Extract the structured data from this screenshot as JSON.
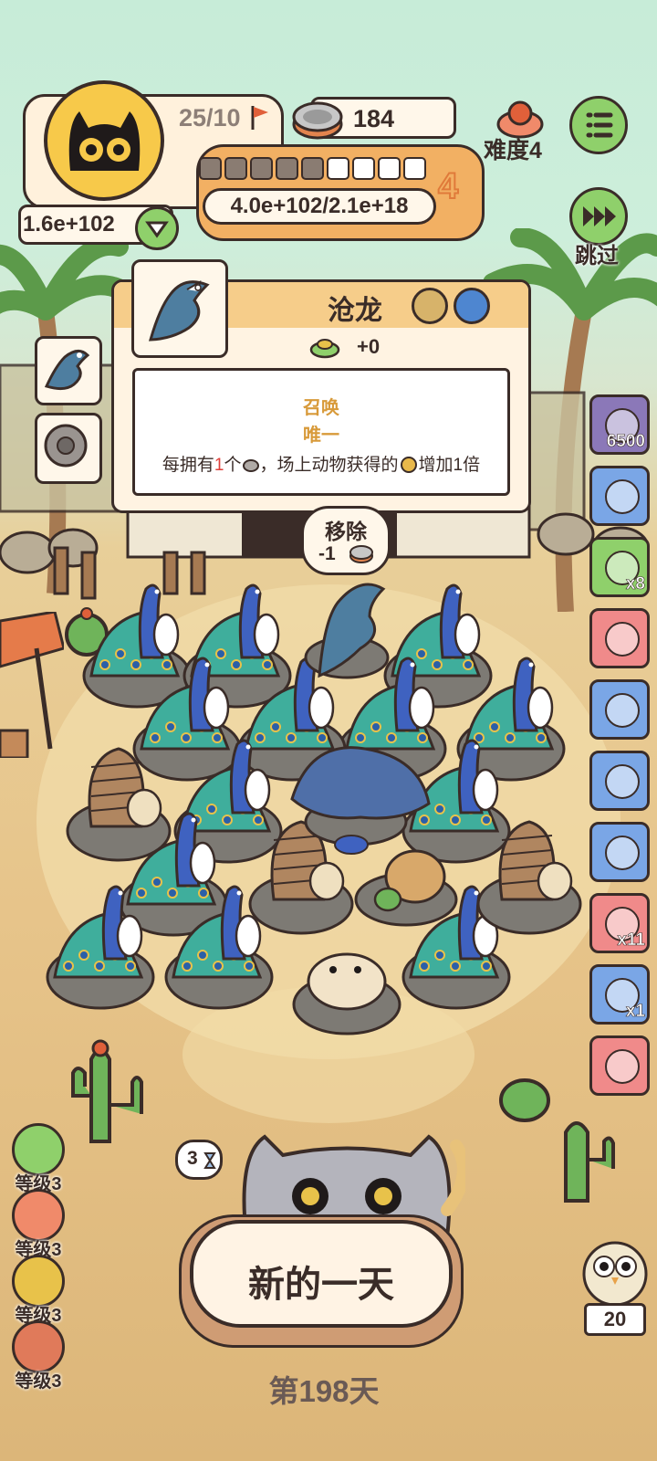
{
  "hud": {
    "capacity": "25/10",
    "cans": "184",
    "difficulty": "难度4",
    "level_number": "4",
    "progress_text": "4.0e+102/2.1e+18",
    "player_score": "1.6e+102",
    "progress_segments": 9,
    "progress_filled": 5,
    "skip_label": "跳过"
  },
  "popup": {
    "name": "沧龙",
    "bonus": "+0",
    "tag1": "召唤",
    "tag2": "唯一",
    "desc_pre": "每拥有",
    "desc_num": "1",
    "desc_mid": "个",
    "desc_post": "，场上动物获得的",
    "desc_end": "增加1倍",
    "remove_label": "移除",
    "remove_cost": "-1"
  },
  "side_buttons": [
    {
      "icon": "stone-film-icon",
      "badge": "6500",
      "color": "#8b78b8"
    },
    {
      "icon": "trophy-icon",
      "badge": "",
      "color": "#7aa6e6"
    },
    {
      "icon": "ticket-icon",
      "badge": "x8",
      "color": "#8fd06b"
    },
    {
      "icon": "paw-plus-icon",
      "badge": "",
      "color": "#f08a8a"
    },
    {
      "icon": "bed-icon",
      "badge": "",
      "color": "#7aa6e6"
    },
    {
      "icon": "backpack-icon",
      "badge": "",
      "color": "#7aa6e6"
    },
    {
      "icon": "jar-icon",
      "badge": "",
      "color": "#7aa6e6"
    },
    {
      "icon": "lock-icon",
      "badge": "x11",
      "color": "#f08a8a"
    },
    {
      "icon": "pot-icon",
      "badge": "x1",
      "color": "#7aa6e6"
    },
    {
      "icon": "feather-icon",
      "badge": "",
      "color": "#f08a8a"
    }
  ],
  "levels": [
    {
      "label": "等级3",
      "color": "#8fd06b"
    },
    {
      "label": "等级3",
      "color": "#f08a6a"
    },
    {
      "label": "等级3",
      "color": "#e8c24a"
    },
    {
      "label": "等级3",
      "color": "#e07a5a"
    }
  ],
  "timer_badge": "3",
  "new_day_button": "新的一天",
  "day_label": "第198天",
  "right_counter": "20",
  "colors": {
    "accent": "#f5a55a",
    "dark": "#3a2c28",
    "green_btn": "#8fd06b"
  }
}
